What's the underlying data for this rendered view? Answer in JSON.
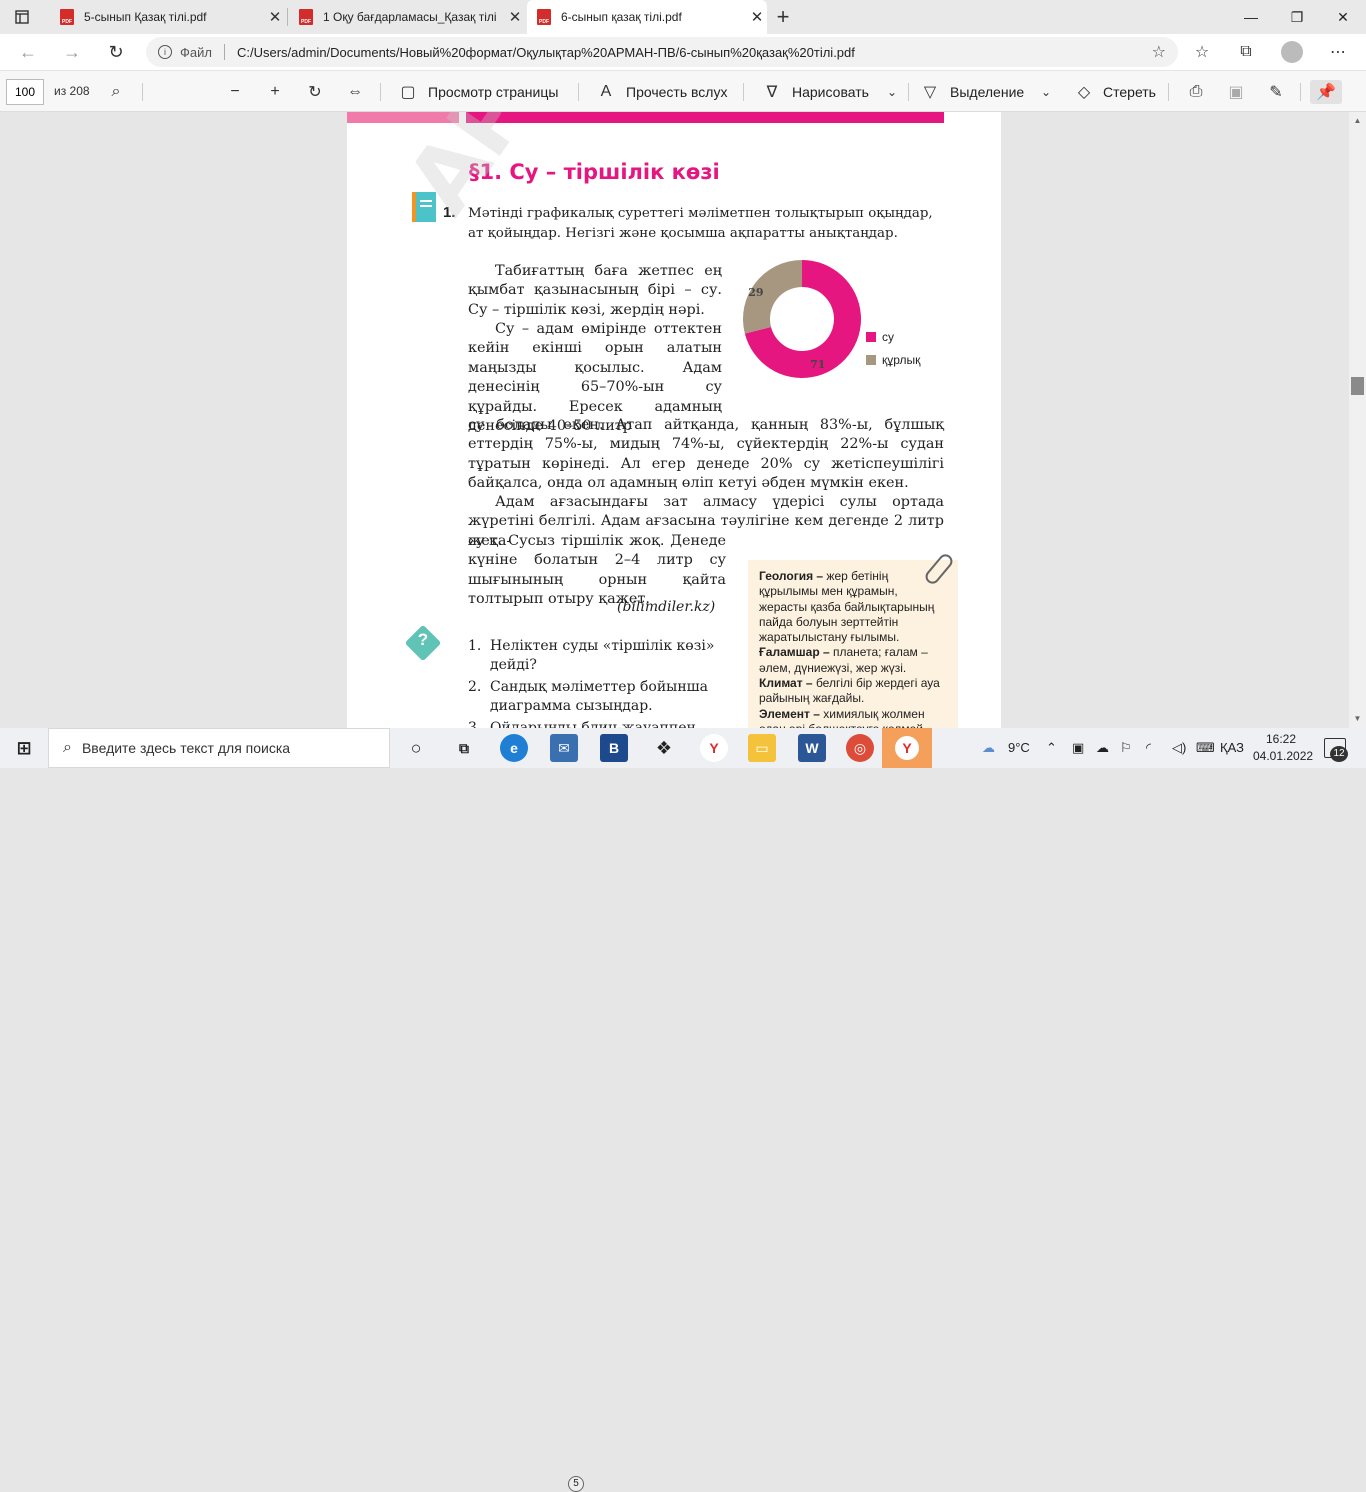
{
  "tabs": [
    {
      "label": "5-сынып Қазақ тілі.pdf",
      "active": false
    },
    {
      "label": "1 Оқу бағдарламасы_Қазақ тілі",
      "active": false
    },
    {
      "label": "6-сынып қазақ тілі.pdf",
      "active": true
    }
  ],
  "address": {
    "scheme_label": "Файл",
    "url": "C:/Users/admin/Documents/Новый%20формат/Оқулықтар%20АРМАН-ПВ/6-сынып%20қазақ%20тілі.pdf"
  },
  "pdf_toolbar": {
    "page_number": "100",
    "page_total": "из 208",
    "view_page": "Просмотр страницы",
    "read_aloud": "Прочесть вслух",
    "draw": "Нарисовать",
    "highlight": "Выделение",
    "erase": "Стереть"
  },
  "page": {
    "heading": "§1. Су – тіршілік көзі",
    "task1_number": "1.",
    "task1_text": "Мәтінді графикалық суреттегі мәліметпен толықтырып оқыңдар, ат қойыңдар. Негізгі және қосымша ақпаратты анықтаңдар.",
    "para1": "Табиғаттың баға жетпес ең қымбат қазынасының бірі – су. Су – тіршілік көзі, жердің нәрі.",
    "para2": "Су – адам өмірінде оттектен кейін екінші орын алатын маңызды қосылыс. Адам денесінің 65–70%-ын су құрайды. Ересек адамның денесінде 40–50 литр",
    "para3": "су болады екен. Атап айтқанда, қанның 83%-ы, бұлшық еттердің 75%-ы, мидың 74%-ы, сүйектердің 22%-ы судан тұратын көрінеді. Ал егер денеде 20% су жетіспеушілігі байқалса, онда ол адамның өліп кетуі әбден мүмкін екен.",
    "para4": "Адам ағзасындағы зат алмасу үдерісі сулы ортада жүретіні белгілі. Адам ағзасына тәулігіне кем дегенде 2 литр су қа-",
    "para5": "жет. Сусыз тіршілік жоқ. Денеде күніне болатын 2–4 литр су шығынының орнын қайта толтырып отыру қажет.",
    "source": "(bilimdiler.kz)",
    "questions": [
      {
        "n": "1.",
        "text": "Неліктен суды «тіршілік көзі» дейді?"
      },
      {
        "n": "2.",
        "text": "Сандық мәліметтер бойынша диаграмма сызыңдар."
      },
      {
        "n": "3.",
        "text": "Ойларыңды блиц-жауаппен жет-"
      }
    ],
    "glossary": [
      {
        "term": "Геология –",
        "def": " жер бетінің құрылымы мен құрамын, жерасты қазба байлықтарының пайда болуын зерттейтін жаратылыстану ғылымы."
      },
      {
        "term": "Ғаламшар –",
        "def": " планета; ғалам – әлем, дүниежүзі, жер жүзі."
      },
      {
        "term": "Климат –",
        "def": " белгілі бір жердегі ауа райының жағдайы."
      },
      {
        "term": "Элемент –",
        "def": " химиялық жолмен одан әрі бөлшектеуге келмей"
      }
    ],
    "watermark": "АРМАН-ПВ баспа"
  },
  "chart_data": {
    "type": "pie",
    "donut": true,
    "categories": [
      "су",
      "құрлық"
    ],
    "values": [
      71,
      29
    ],
    "colors": [
      "#e5167f",
      "#a79780"
    ],
    "legend_position": "right"
  },
  "taskbar": {
    "search_placeholder": "Введите здесь текст для поиска",
    "mail_badge": "5",
    "temperature": "9°C",
    "lang": "ҚАЗ",
    "time": "16:22",
    "date": "04.01.2022",
    "notifications": "12"
  }
}
